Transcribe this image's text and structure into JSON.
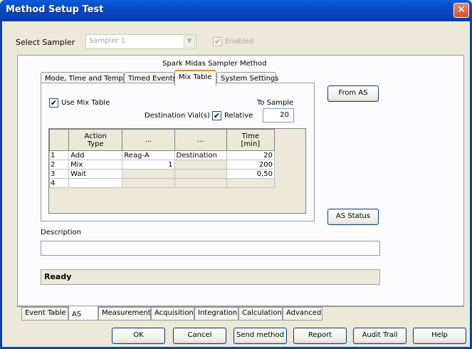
{
  "window": {
    "title": "Method Setup Test",
    "close_glyph": "✕"
  },
  "sampler": {
    "label": "Select Sampler",
    "value": "Sampler 1",
    "enabled_label": "Enabled",
    "dropdown_glyph": "▼"
  },
  "method_title": "Spark Midas Sampler Method",
  "inner_tabs": [
    "Mode, Time and Temp.",
    "Timed Events",
    "Mix Table",
    "System Settings"
  ],
  "inner_active_tab": "Mix Table",
  "mix": {
    "use_mix_label": "Use Mix Table",
    "to_sample_label": "To Sample",
    "dest_vial_label": "Destination Vial(s)",
    "relative_label": "Relative",
    "to_sample_value": "20"
  },
  "grid": {
    "headers": [
      "Action\nType",
      "...",
      "...",
      "Time\n[min]"
    ],
    "rows": [
      {
        "n": "1",
        "c1": "Add",
        "c2": "Reag-A",
        "c3": "Destination",
        "c4": "20"
      },
      {
        "n": "2",
        "c1": "Mix",
        "c2": "1",
        "c3": "",
        "c4": "200"
      },
      {
        "n": "3",
        "c1": "Wait",
        "c2": "",
        "c3": "",
        "c4": "0,50"
      },
      {
        "n": "4",
        "c1": "",
        "c2": "",
        "c3": "",
        "c4": ""
      }
    ]
  },
  "buttons": {
    "from_as": "From AS",
    "as_status": "AS Status"
  },
  "description": {
    "label": "Description",
    "value": ""
  },
  "status": "Ready",
  "bottom_tabs": [
    "Event Table",
    "AS",
    "Measurement",
    "Acquisition",
    "Integration",
    "Calculation",
    "Advanced"
  ],
  "bottom_active_tab": "AS",
  "footer": {
    "ok": "OK",
    "cancel": "Cancel",
    "send_method": "Send method",
    "report": "Report",
    "audit_trail": "Audit Trail",
    "help": "Help"
  },
  "icons": {
    "checkmark": "✔"
  }
}
